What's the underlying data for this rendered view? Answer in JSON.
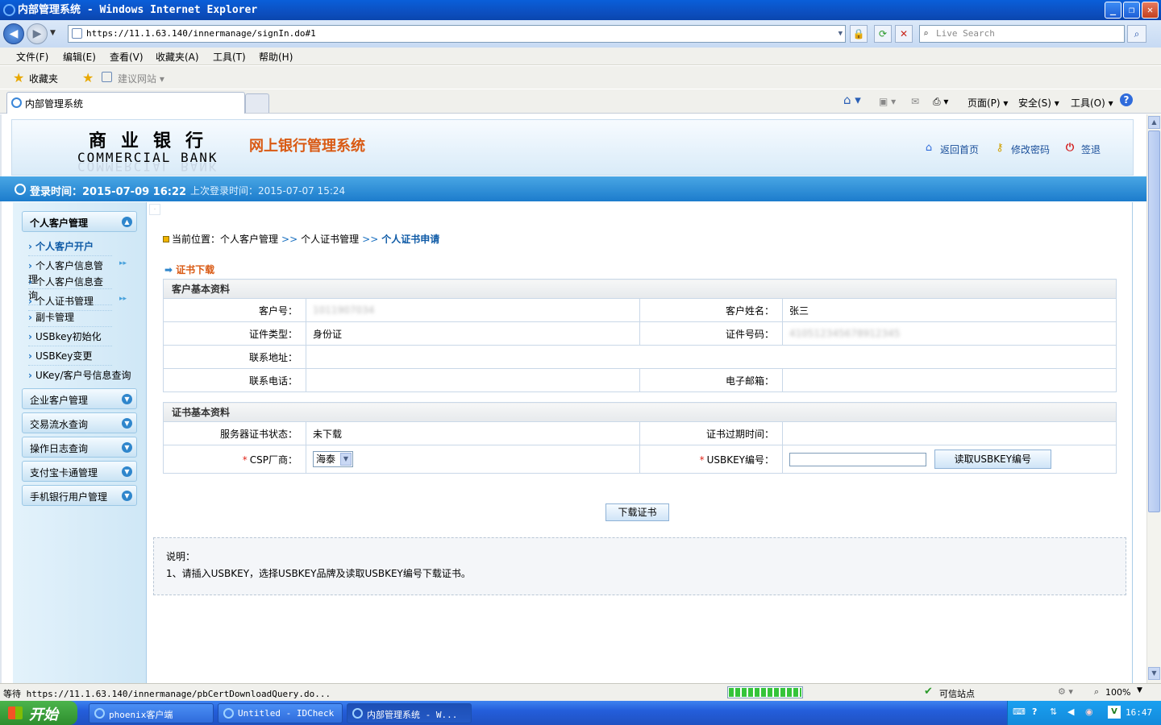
{
  "window": {
    "title": "内部管理系统 - Windows Internet Explorer",
    "buttons": [
      "_",
      "❐",
      "✕"
    ]
  },
  "address": {
    "url": "https://11.1.63.140/innermanage/signIn.do#1",
    "search_placeholder": "Live Search"
  },
  "menu": [
    "文件(F)",
    "编辑(E)",
    "查看(V)",
    "收藏夹(A)",
    "工具(T)",
    "帮助(H)"
  ],
  "favorites": {
    "label": "收藏夹",
    "suggest": "建议网站 ▾"
  },
  "tab": {
    "label": "内部管理系统"
  },
  "commandbar": {
    "page": "页面(P) ▾",
    "safety": "安全(S) ▾",
    "tools": "工具(O) ▾",
    "help": "?"
  },
  "header": {
    "bank_cn": "商业银行",
    "bank_en": "COMMERCIAL BANK",
    "system_title": "网上银行管理系统",
    "links": {
      "home": "返回首页",
      "password": "修改密码",
      "logout": "签退"
    }
  },
  "login": {
    "current": "登录时间：2015-07-09 16:22",
    "last": "上次登录时间：2015-07-07 15:24"
  },
  "sidebar": {
    "groups": [
      {
        "label": "个人客户管理",
        "expanded": true
      },
      {
        "label": "企业客户管理"
      },
      {
        "label": "交易流水查询"
      },
      {
        "label": "操作日志查询"
      },
      {
        "label": "支付宝卡通管理"
      },
      {
        "label": "手机银行用户管理"
      }
    ],
    "items": [
      {
        "label": "个人客户开户",
        "active": true
      },
      {
        "label": "个人客户信息管理",
        "has_sub": true
      },
      {
        "label": "个人客户信息查询"
      },
      {
        "label": "个人证书管理",
        "has_sub": true
      },
      {
        "label": "副卡管理"
      },
      {
        "label": "USBkey初始化"
      },
      {
        "label": "USBKey变更"
      },
      {
        "label": "UKey/客户号信息查询"
      }
    ],
    "more_glyph": "▸▸",
    "collapse_glyph": "▲",
    "expand_glyph": "▼"
  },
  "breadcrumb": {
    "prefix": "当前位置：",
    "p1": "个人客户管理",
    "p2": "个人证书管理",
    "p3": "个人证书申请",
    "sep": ">>"
  },
  "section_title": "证书下载",
  "customer": {
    "caption": "客户基本资料",
    "fields": {
      "cust_no_label": "客户号：",
      "cust_no": "1011907034",
      "name_label": "客户姓名：",
      "name": "张三",
      "id_type_label": "证件类型：",
      "id_type": "身份证",
      "id_no_label": "证件号码：",
      "id_no": "410512345678912345",
      "address_label": "联系地址：",
      "address": "",
      "phone_label": "联系电话：",
      "phone": "",
      "email_label": "电子邮箱：",
      "email": ""
    }
  },
  "certificate": {
    "caption": "证书基本资料",
    "status_label": "服务器证书状态：",
    "status": "未下载",
    "expire_label": "证书过期时间：",
    "expire": "",
    "csp_label": "CSP厂商：",
    "csp_value": "海泰",
    "usbkey_label": "USBKEY编号：",
    "usbkey_value": "",
    "read_button": "读取USBKEY编号",
    "required_mark": "*"
  },
  "download_button": "下载证书",
  "note": {
    "title": "说明：",
    "line1": "1、请插入USBKEY，选择USBKEY品牌及读取USBKEY编号下载证书。"
  },
  "status": {
    "text": "等待 https://11.1.63.140/innermanage/pbCertDownloadQuery.do...",
    "progress": 1.0,
    "trusted": "可信站点",
    "zoom": "100%"
  },
  "taskbar": {
    "start": "开始",
    "tasks": [
      "phoenix客户端",
      "Untitled - IDCheck",
      "内部管理系统 - W..."
    ],
    "clock": "16:47"
  },
  "colors": {
    "accent": "#1c7ccc",
    "title_orange": "#d95a14",
    "link": "#1a4f9a"
  }
}
